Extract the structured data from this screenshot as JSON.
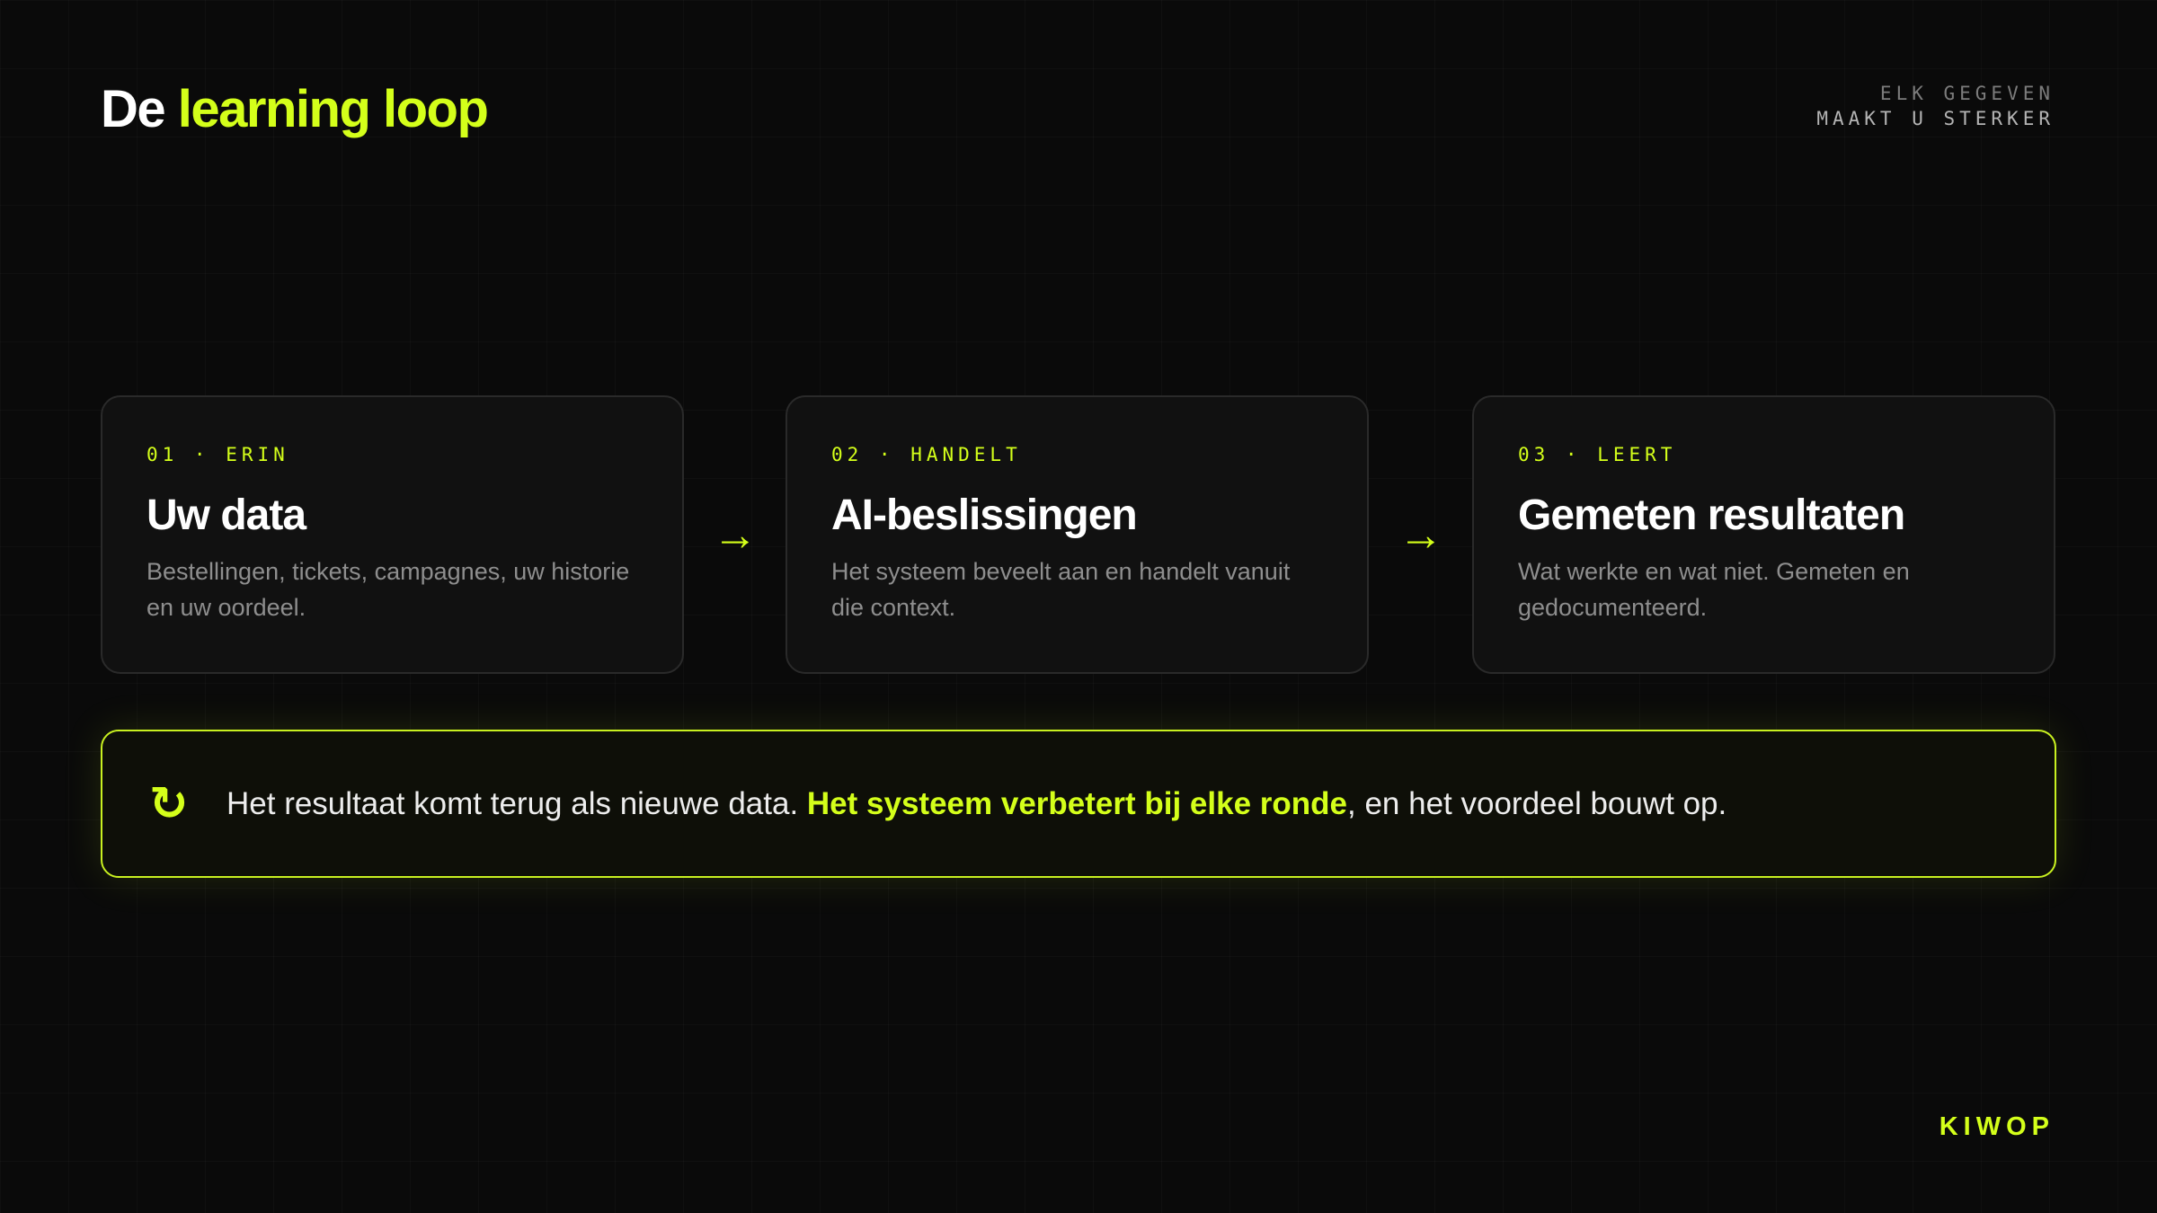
{
  "header": {
    "title_prefix": "De",
    "title_accent": "learning loop",
    "tagline_line1": "ELK GEGEVEN",
    "tagline_line2": "MAAKT U STERKER"
  },
  "steps": [
    {
      "kicker": "01 · ERIN",
      "title": "Uw data",
      "description": "Bestellingen, tickets, campagnes, uw historie en uw oordeel."
    },
    {
      "kicker": "02 · HANDELT",
      "title": "AI-beslissingen",
      "description": "Het systeem beveelt aan en handelt vanuit die context."
    },
    {
      "kicker": "03 · LEERT",
      "title": "Gemeten resultaten",
      "description": "Wat werkte en wat niet. Gemeten en gedocumenteerd."
    }
  ],
  "arrows": {
    "symbol": "→"
  },
  "loop": {
    "icon": "↻",
    "icon_name": "loop-refresh-icon",
    "text_before": "Het resultaat komt terug als nieuwe data. ",
    "text_highlight": "Het systeem verbetert bij elke ronde",
    "text_after": ", en het voordeel bouwt op."
  },
  "brand": {
    "name": "KIWOP"
  },
  "colors": {
    "background": "#0a0a0a",
    "accent": "#d4ff1a",
    "card_background": "#111111",
    "card_border": "#2a2a2a",
    "muted_text": "#8e8e8e"
  }
}
